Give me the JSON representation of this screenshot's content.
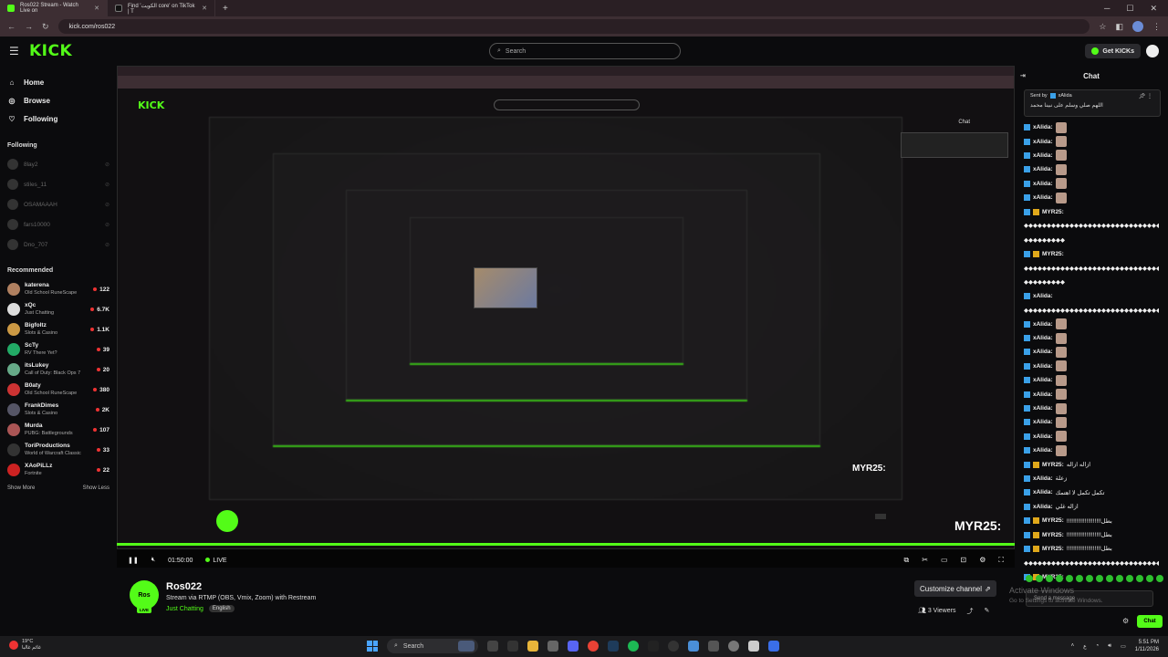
{
  "browser": {
    "tabs": [
      {
        "label": "Ros022 Stream - Watch Live on",
        "active": true
      },
      {
        "label": "Find 'الكويت core' on TikTok | T",
        "active": false
      }
    ],
    "url": "kick.com/ros022"
  },
  "header": {
    "logo": "KICK",
    "search_placeholder": "Search",
    "get_kicks": "Get KICKs"
  },
  "sidebar": {
    "nav": [
      {
        "label": "Home",
        "icon": "home-icon"
      },
      {
        "label": "Browse",
        "icon": "compass-icon"
      },
      {
        "label": "Following",
        "icon": "heart-icon"
      }
    ],
    "following_title": "Following",
    "following": [
      "8lay2",
      "stiles_11",
      "OSAMAAAH",
      "fars10000",
      "Dno_707"
    ],
    "recommended_title": "Recommended",
    "recommended": [
      {
        "name": "katerena",
        "category": "Old School RuneScape",
        "viewers": "122",
        "color": "#b08060"
      },
      {
        "name": "xQc",
        "category": "Just Chatting",
        "viewers": "6.7K",
        "color": "#ddd"
      },
      {
        "name": "Bigfoltz",
        "category": "Slots & Casino",
        "viewers": "1.1K",
        "color": "#c94"
      },
      {
        "name": "ScTy",
        "category": "RV There Yet?",
        "viewers": "39",
        "color": "#2a6"
      },
      {
        "name": "itsLukey",
        "category": "Call of Duty: Black Ops 7",
        "viewers": "20",
        "color": "#6a8"
      },
      {
        "name": "B0aty",
        "category": "Old School RuneScape",
        "viewers": "380",
        "color": "#c33"
      },
      {
        "name": "FrankDimes",
        "category": "Slots & Casino",
        "viewers": "2K",
        "color": "#556"
      },
      {
        "name": "Murda",
        "category": "PUBG: Battlegrounds",
        "viewers": "107",
        "color": "#a55"
      },
      {
        "name": "ToriProductions",
        "category": "World of Warcraft Classic",
        "viewers": "33",
        "color": "#333"
      },
      {
        "name": "XAoPiLLz",
        "category": "Fortnite",
        "viewers": "22",
        "color": "#c22"
      }
    ],
    "show_more": "Show More",
    "show_less": "Show Less"
  },
  "player": {
    "time": "01:50:00",
    "live": "LIVE",
    "overflow_name": "MYR25:"
  },
  "channel": {
    "name": "Ros022",
    "title": "Stream via RTMP (OBS, Vmix, Zoom) with Restream",
    "category": "Just Chatting",
    "tag": "English",
    "customize": "Customize channel",
    "viewers": "3 Viewers",
    "avatar_text": "Ros",
    "live_badge": "LIVE"
  },
  "chat": {
    "title": "Chat",
    "pinned": {
      "sent_by": "Sent by",
      "user": "xAlida",
      "message": "اللهم صلي وسلم على نبينا محمد"
    },
    "messages": [
      {
        "user": "xAlida:",
        "text": "",
        "emote": true,
        "badge": "b"
      },
      {
        "user": "xAlida:",
        "text": "",
        "emote": true,
        "badge": "b"
      },
      {
        "user": "xAlida:",
        "text": "",
        "emote": true,
        "badge": "b"
      },
      {
        "user": "xAlida:",
        "text": "",
        "emote": true,
        "badge": "b"
      },
      {
        "user": "xAlida:",
        "text": "",
        "emote": true,
        "badge": "b"
      },
      {
        "user": "xAlida:",
        "text": "",
        "emote": true,
        "badge": "b"
      },
      {
        "user": "MYR25:",
        "text": "",
        "emote": false,
        "badge": "b2"
      },
      {
        "user": "",
        "text": "◆◆◆◆◆◆◆◆◆◆◆◆◆◆◆◆◆◆◆◆◆◆◆◆◆◆◆◆◆◆◆◆◆◆◆◆◆◆◆◆◆◆◆◆",
        "emote": false,
        "badge": ""
      },
      {
        "user": "",
        "text": "◆◆◆◆◆◆◆◆◆",
        "emote": false,
        "badge": ""
      },
      {
        "user": "MYR25:",
        "text": "",
        "emote": false,
        "badge": "b2"
      },
      {
        "user": "",
        "text": "◆◆◆◆◆◆◆◆◆◆◆◆◆◆◆◆◆◆◆◆◆◆◆◆◆◆◆◆◆◆◆◆◆◆◆◆◆◆◆◆◆◆◆◆",
        "emote": false,
        "badge": ""
      },
      {
        "user": "",
        "text": "◆◆◆◆◆◆◆◆◆",
        "emote": false,
        "badge": ""
      },
      {
        "user": "xAlida:",
        "text": "",
        "emote": false,
        "badge": "b"
      },
      {
        "user": "",
        "text": "◆◆◆◆◆◆◆◆◆◆◆◆◆◆◆◆◆◆◆◆◆◆◆◆◆◆◆◆◆◆◆◆◆◆◆◆◆◆◆◆◆◆◆◆",
        "emote": false,
        "badge": ""
      },
      {
        "user": "xAlida:",
        "text": "",
        "emote": true,
        "badge": "b"
      },
      {
        "user": "xAlida:",
        "text": "",
        "emote": true,
        "badge": "b"
      },
      {
        "user": "xAlida:",
        "text": "",
        "emote": true,
        "badge": "b"
      },
      {
        "user": "xAlida:",
        "text": "",
        "emote": true,
        "badge": "b"
      },
      {
        "user": "xAlida:",
        "text": "",
        "emote": true,
        "badge": "b"
      },
      {
        "user": "xAlida:",
        "text": "",
        "emote": true,
        "badge": "b"
      },
      {
        "user": "xAlida:",
        "text": "",
        "emote": true,
        "badge": "b"
      },
      {
        "user": "xAlida:",
        "text": "",
        "emote": true,
        "badge": "b"
      },
      {
        "user": "xAlida:",
        "text": "",
        "emote": true,
        "badge": "b"
      },
      {
        "user": "xAlida:",
        "text": "",
        "emote": true,
        "badge": "b"
      },
      {
        "user": "MYR25:",
        "text": "ازاله ازاله",
        "emote": false,
        "badge": "b2"
      },
      {
        "user": "xAlida:",
        "text": "زعلة",
        "emote": false,
        "badge": "b"
      },
      {
        "user": "xAlida:",
        "text": "تكمل تكمل لا اهتمك",
        "emote": false,
        "badge": "b"
      },
      {
        "user": "xAlida:",
        "text": "ازاله غلي",
        "emote": false,
        "badge": "b"
      },
      {
        "user": "MYR25:",
        "text": "!!!!!!!!!!!!!!!!!!!!!بطل",
        "emote": false,
        "badge": "b2"
      },
      {
        "user": "MYR25:",
        "text": "!!!!!!!!!!!!!!!!!!!!!بطل",
        "emote": false,
        "badge": "b2"
      },
      {
        "user": "MYR25:",
        "text": "!!!!!!!!!!!!!!!!!!!!!بطل",
        "emote": false,
        "badge": "b2"
      },
      {
        "user": "",
        "text": "◆◆◆◆◆◆◆◆◆◆◆◆◆◆◆◆◆◆◆◆◆◆◆◆◆◆◆◆◆◆◆◆◆◆◆◆◆◆◆◆◆◆◆◆",
        "emote": false,
        "badge": ""
      },
      {
        "user": "MYR25:",
        "text": "",
        "emote": false,
        "badge": "b2"
      }
    ],
    "input_placeholder": "Send a message",
    "send": "Chat",
    "activate_title": "Activate Windows",
    "activate_sub": "Go to Settings to activate Windows."
  },
  "taskbar": {
    "temp": "19°C",
    "weather_text": "غائم غالبا",
    "search": "Search",
    "time": "5:51 PM",
    "date": "1/11/2026",
    "lang": "ع"
  }
}
